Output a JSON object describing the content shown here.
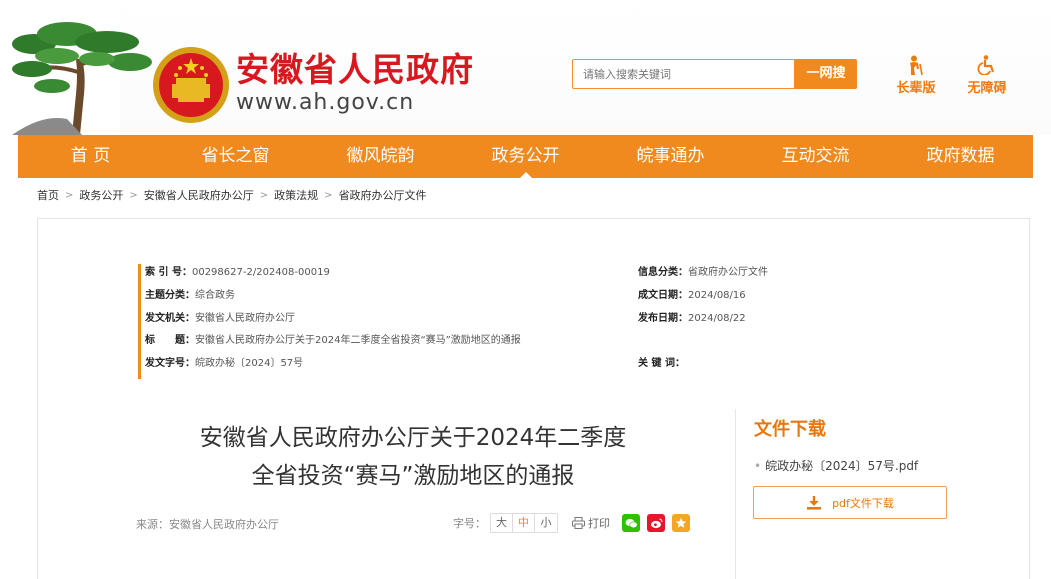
{
  "header": {
    "site_name": "安徽省人民政府",
    "site_url": "www.ah.gov.cn",
    "search": {
      "placeholder": "请输入搜索关键词",
      "button_label": "一网搜"
    },
    "tools": {
      "elder": "长辈版",
      "accessible": "无障碍"
    },
    "accent_color": "#f08a1e",
    "brand_red": "#d7181f"
  },
  "nav": {
    "items": [
      {
        "label": "首 页"
      },
      {
        "label": "省长之窗"
      },
      {
        "label": "徽风皖韵"
      },
      {
        "label": "政务公开",
        "active": true
      },
      {
        "label": "皖事通办"
      },
      {
        "label": "互动交流"
      },
      {
        "label": "政府数据"
      }
    ]
  },
  "breadcrumb": [
    "首页",
    "政务公开",
    "安徽省人民政府办公厅",
    "政策法规",
    "省政府办公厅文件"
  ],
  "meta": {
    "index_no": {
      "key": "索 引 号：",
      "value": "00298627-2/202408-00019"
    },
    "topic": {
      "key": "主题分类：",
      "value": "综合政务"
    },
    "issuer": {
      "key": "发文机关：",
      "value": "安徽省人民政府办公厅"
    },
    "title": {
      "key": "标　　题：",
      "value": "安徽省人民政府办公厅关于2024年二季度全省投资“赛马”激励地区的通报"
    },
    "doc_no": {
      "key": "发文字号：",
      "value": "皖政办秘〔2024〕57号"
    },
    "info_category": {
      "key": "信息分类：",
      "value": "省政府办公厅文件"
    },
    "written_date": {
      "key": "成文日期：",
      "value": "2024/08/16"
    },
    "publish_date": {
      "key": "发布日期：",
      "value": "2024/08/22"
    },
    "keywords": {
      "key": "关 键 词：",
      "value": ""
    }
  },
  "article": {
    "title_line1": "安徽省人民政府办公厅关于2024年二季度",
    "title_line2": "全省投资“赛马”激励地区的通报",
    "source": "来源：安徽省人民政府办公厅",
    "font_size_label": "字号：",
    "font_sizes": [
      "大",
      "中",
      "小"
    ],
    "print_label": "打印"
  },
  "downloads": {
    "title": "文件下载",
    "file_name": "皖政办秘〔2024〕57号.pdf",
    "button_label": "pdf文件下载"
  }
}
